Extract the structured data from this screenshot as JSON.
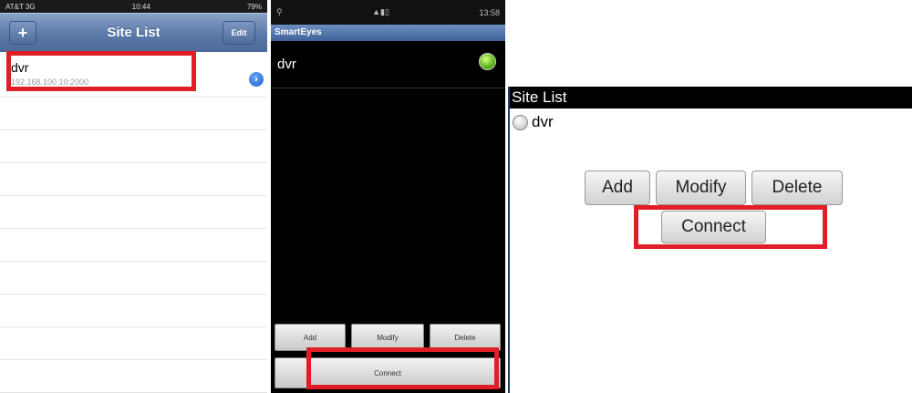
{
  "ios": {
    "status": {
      "carrier": "AT&T 3G",
      "time": "10:44",
      "battery": "79%"
    },
    "title": "Site List",
    "add_label": "+",
    "edit_label": "Edit",
    "site": {
      "name": "dvr",
      "address": "192.168.100.10:2000"
    },
    "disclosure_icon": "disclosure-chevron-icon"
  },
  "android": {
    "status": {
      "time": "13:58"
    },
    "title": "SmartEyes",
    "site": {
      "name": "dvr",
      "status_color": "#59b21c"
    },
    "buttons": {
      "add": "Add",
      "modify": "Modify",
      "delete": "Delete",
      "connect": "Connect"
    }
  },
  "blackberry": {
    "title": "Site List",
    "site": {
      "name": "dvr"
    },
    "buttons": {
      "add": "Add",
      "modify": "Modify",
      "delete": "Delete",
      "connect": "Connect"
    }
  },
  "highlight_color": "#e01e25"
}
